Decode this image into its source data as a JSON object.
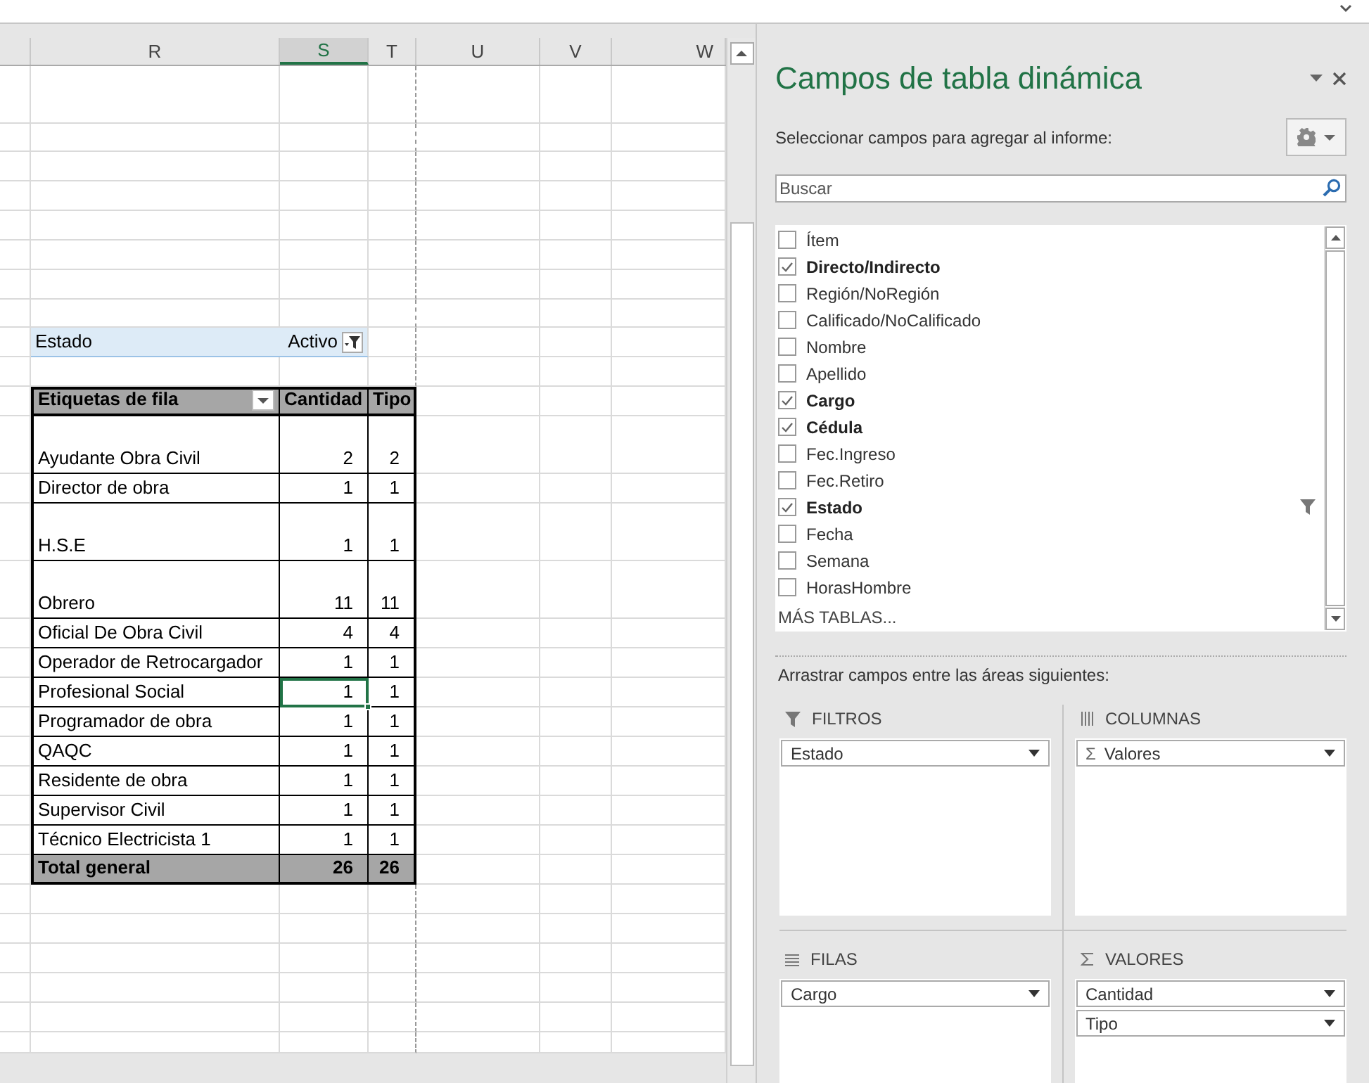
{
  "sheet": {
    "columns": [
      {
        "label": "R",
        "selected": false
      },
      {
        "label": "S",
        "selected": true
      },
      {
        "label": "T",
        "selected": false
      },
      {
        "label": "U",
        "selected": false
      },
      {
        "label": "V",
        "selected": false
      },
      {
        "label": "W",
        "selected": false
      }
    ],
    "report_filter": {
      "field": "Estado",
      "value": "Activo"
    },
    "pivot": {
      "header": [
        "Etiquetas de fila",
        "Cantidad",
        "Tipo"
      ],
      "rows": [
        {
          "label": "Ayudante Obra Civil",
          "cantidad": "2",
          "tipo": "2",
          "selected": false
        },
        {
          "label": "Director de obra",
          "cantidad": "1",
          "tipo": "1",
          "selected": false
        },
        {
          "label": "H.S.E",
          "cantidad": "1",
          "tipo": "1",
          "selected": false
        },
        {
          "label": "Obrero",
          "cantidad": "11",
          "tipo": "11",
          "selected": false
        },
        {
          "label": "Oficial De Obra Civil",
          "cantidad": "4",
          "tipo": "4",
          "selected": false
        },
        {
          "label": "Operador de Retrocargador",
          "cantidad": "1",
          "tipo": "1",
          "selected": false
        },
        {
          "label": "Profesional Social",
          "cantidad": "1",
          "tipo": "1",
          "selected": true
        },
        {
          "label": "Programador de obra",
          "cantidad": "1",
          "tipo": "1",
          "selected": false
        },
        {
          "label": "QAQC",
          "cantidad": "1",
          "tipo": "1",
          "selected": false
        },
        {
          "label": "Residente de obra",
          "cantidad": "1",
          "tipo": "1",
          "selected": false
        },
        {
          "label": "Supervisor Civil",
          "cantidad": "1",
          "tipo": "1",
          "selected": false
        },
        {
          "label": "Técnico Electricista 1",
          "cantidad": "1",
          "tipo": "1",
          "selected": false
        }
      ],
      "total": {
        "label": "Total general",
        "cantidad": "26",
        "tipo": "26"
      }
    }
  },
  "panel": {
    "title": "Campos de tabla dinámica",
    "subtitle": "Seleccionar campos para agregar al informe:",
    "search": {
      "placeholder": "Buscar"
    },
    "fields": [
      {
        "label": "Ítem",
        "checked": false,
        "filtered": false
      },
      {
        "label": "Directo/Indirecto",
        "checked": true,
        "filtered": false
      },
      {
        "label": "Región/NoRegión",
        "checked": false,
        "filtered": false
      },
      {
        "label": "Calificado/NoCalificado",
        "checked": false,
        "filtered": false
      },
      {
        "label": "Nombre",
        "checked": false,
        "filtered": false
      },
      {
        "label": "Apellido",
        "checked": false,
        "filtered": false
      },
      {
        "label": "Cargo",
        "checked": true,
        "filtered": false
      },
      {
        "label": "Cédula",
        "checked": true,
        "filtered": false
      },
      {
        "label": "Fec.Ingreso",
        "checked": false,
        "filtered": false
      },
      {
        "label": "Fec.Retiro",
        "checked": false,
        "filtered": false
      },
      {
        "label": "Estado",
        "checked": true,
        "filtered": true
      },
      {
        "label": "Fecha",
        "checked": false,
        "filtered": false
      },
      {
        "label": "Semana",
        "checked": false,
        "filtered": false
      },
      {
        "label": "HorasHombre",
        "checked": false,
        "filtered": false
      }
    ],
    "more_tables": "MÁS TABLAS...",
    "drag_hint": "Arrastrar campos entre las áreas siguientes:",
    "areas": [
      {
        "kind": "filters",
        "label": "FILTROS",
        "items": [
          {
            "label": "Estado"
          }
        ]
      },
      {
        "kind": "columns",
        "label": "COLUMNAS",
        "items": [
          {
            "symbol": "Σ",
            "label": "Valores"
          }
        ]
      },
      {
        "kind": "rows",
        "label": "FILAS",
        "items": [
          {
            "label": "Cargo"
          }
        ]
      },
      {
        "kind": "values",
        "label": "VALORES",
        "items": [
          {
            "label": "Cantidad"
          },
          {
            "label": "Tipo"
          }
        ]
      }
    ]
  }
}
